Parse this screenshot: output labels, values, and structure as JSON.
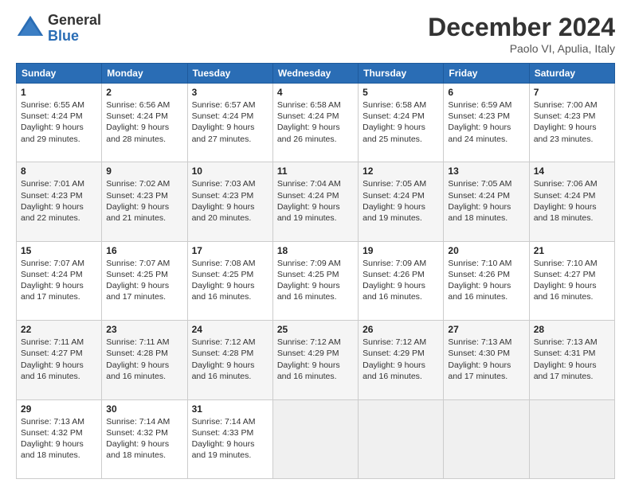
{
  "logo": {
    "general": "General",
    "blue": "Blue"
  },
  "title": {
    "month_year": "December 2024",
    "location": "Paolo VI, Apulia, Italy"
  },
  "days_of_week": [
    "Sunday",
    "Monday",
    "Tuesday",
    "Wednesday",
    "Thursday",
    "Friday",
    "Saturday"
  ],
  "weeks": [
    [
      {
        "day": "1",
        "sunrise": "6:55 AM",
        "sunset": "4:24 PM",
        "daylight": "9 hours and 29 minutes."
      },
      {
        "day": "2",
        "sunrise": "6:56 AM",
        "sunset": "4:24 PM",
        "daylight": "9 hours and 28 minutes."
      },
      {
        "day": "3",
        "sunrise": "6:57 AM",
        "sunset": "4:24 PM",
        "daylight": "9 hours and 27 minutes."
      },
      {
        "day": "4",
        "sunrise": "6:58 AM",
        "sunset": "4:24 PM",
        "daylight": "9 hours and 26 minutes."
      },
      {
        "day": "5",
        "sunrise": "6:58 AM",
        "sunset": "4:24 PM",
        "daylight": "9 hours and 25 minutes."
      },
      {
        "day": "6",
        "sunrise": "6:59 AM",
        "sunset": "4:23 PM",
        "daylight": "9 hours and 24 minutes."
      },
      {
        "day": "7",
        "sunrise": "7:00 AM",
        "sunset": "4:23 PM",
        "daylight": "9 hours and 23 minutes."
      }
    ],
    [
      {
        "day": "8",
        "sunrise": "7:01 AM",
        "sunset": "4:23 PM",
        "daylight": "9 hours and 22 minutes."
      },
      {
        "day": "9",
        "sunrise": "7:02 AM",
        "sunset": "4:23 PM",
        "daylight": "9 hours and 21 minutes."
      },
      {
        "day": "10",
        "sunrise": "7:03 AM",
        "sunset": "4:23 PM",
        "daylight": "9 hours and 20 minutes."
      },
      {
        "day": "11",
        "sunrise": "7:04 AM",
        "sunset": "4:24 PM",
        "daylight": "9 hours and 19 minutes."
      },
      {
        "day": "12",
        "sunrise": "7:05 AM",
        "sunset": "4:24 PM",
        "daylight": "9 hours and 19 minutes."
      },
      {
        "day": "13",
        "sunrise": "7:05 AM",
        "sunset": "4:24 PM",
        "daylight": "9 hours and 18 minutes."
      },
      {
        "day": "14",
        "sunrise": "7:06 AM",
        "sunset": "4:24 PM",
        "daylight": "9 hours and 18 minutes."
      }
    ],
    [
      {
        "day": "15",
        "sunrise": "7:07 AM",
        "sunset": "4:24 PM",
        "daylight": "9 hours and 17 minutes."
      },
      {
        "day": "16",
        "sunrise": "7:07 AM",
        "sunset": "4:25 PM",
        "daylight": "9 hours and 17 minutes."
      },
      {
        "day": "17",
        "sunrise": "7:08 AM",
        "sunset": "4:25 PM",
        "daylight": "9 hours and 16 minutes."
      },
      {
        "day": "18",
        "sunrise": "7:09 AM",
        "sunset": "4:25 PM",
        "daylight": "9 hours and 16 minutes."
      },
      {
        "day": "19",
        "sunrise": "7:09 AM",
        "sunset": "4:26 PM",
        "daylight": "9 hours and 16 minutes."
      },
      {
        "day": "20",
        "sunrise": "7:10 AM",
        "sunset": "4:26 PM",
        "daylight": "9 hours and 16 minutes."
      },
      {
        "day": "21",
        "sunrise": "7:10 AM",
        "sunset": "4:27 PM",
        "daylight": "9 hours and 16 minutes."
      }
    ],
    [
      {
        "day": "22",
        "sunrise": "7:11 AM",
        "sunset": "4:27 PM",
        "daylight": "9 hours and 16 minutes."
      },
      {
        "day": "23",
        "sunrise": "7:11 AM",
        "sunset": "4:28 PM",
        "daylight": "9 hours and 16 minutes."
      },
      {
        "day": "24",
        "sunrise": "7:12 AM",
        "sunset": "4:28 PM",
        "daylight": "9 hours and 16 minutes."
      },
      {
        "day": "25",
        "sunrise": "7:12 AM",
        "sunset": "4:29 PM",
        "daylight": "9 hours and 16 minutes."
      },
      {
        "day": "26",
        "sunrise": "7:12 AM",
        "sunset": "4:29 PM",
        "daylight": "9 hours and 16 minutes."
      },
      {
        "day": "27",
        "sunrise": "7:13 AM",
        "sunset": "4:30 PM",
        "daylight": "9 hours and 17 minutes."
      },
      {
        "day": "28",
        "sunrise": "7:13 AM",
        "sunset": "4:31 PM",
        "daylight": "9 hours and 17 minutes."
      }
    ],
    [
      {
        "day": "29",
        "sunrise": "7:13 AM",
        "sunset": "4:32 PM",
        "daylight": "9 hours and 18 minutes."
      },
      {
        "day": "30",
        "sunrise": "7:14 AM",
        "sunset": "4:32 PM",
        "daylight": "9 hours and 18 minutes."
      },
      {
        "day": "31",
        "sunrise": "7:14 AM",
        "sunset": "4:33 PM",
        "daylight": "9 hours and 19 minutes."
      },
      null,
      null,
      null,
      null
    ]
  ]
}
